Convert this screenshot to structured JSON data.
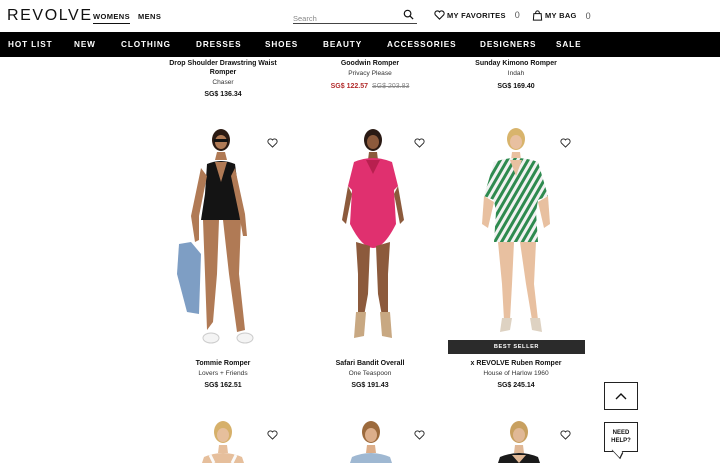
{
  "header": {
    "logo": "REVOLVE",
    "gender_tabs": [
      "WOMENS",
      "MENS"
    ],
    "search": {
      "placeholder": "Search"
    },
    "favorites": {
      "label": "MY FAVORITES",
      "count": "0"
    },
    "bag": {
      "label": "MY BAG",
      "count": "0"
    }
  },
  "nav": {
    "items": [
      "HOT LIST",
      "NEW",
      "CLOTHING",
      "DRESSES",
      "SHOES",
      "BEAUTY",
      "ACCESSORIES",
      "DESIGNERS",
      "SALE"
    ]
  },
  "products": {
    "row1": [
      {
        "name_line1": "Drop Shoulder Drawstring Waist",
        "name_line2": "Romper",
        "brand": "Chaser",
        "price": "SG$ 136.34"
      },
      {
        "name_line1": "Goodwin Romper",
        "brand": "Privacy Please",
        "sale_price": "SG$ 122.57",
        "original_price": "SG$ 203.83"
      },
      {
        "name_line1": "Sunday Kimono Romper",
        "brand": "Indah",
        "price": "SG$ 169.40"
      }
    ],
    "row2": [
      {
        "name": "Tommie Romper",
        "brand": "Lovers + Friends",
        "price": "SG$ 162.51",
        "outfit_color": "#141414"
      },
      {
        "name": "Safari Bandit Overall",
        "brand": "One Teaspoon",
        "price": "SG$ 191.43",
        "outfit_color": "#e0306f"
      },
      {
        "name": "x REVOLVE Ruben Romper",
        "brand": "House of Harlow 1960",
        "price": "SG$ 245.14",
        "badge": "BEST SELLER",
        "outfit_color": "#2e8a4f"
      }
    ]
  },
  "floating": {
    "help_line1": "NEED",
    "help_line2": "HELP?"
  },
  "icons": {
    "search": "search-icon",
    "favorites": "heart-icon",
    "bag": "bag-icon",
    "wishlist": "heart-outline-icon",
    "back_to_top": "chevron-up-icon"
  }
}
